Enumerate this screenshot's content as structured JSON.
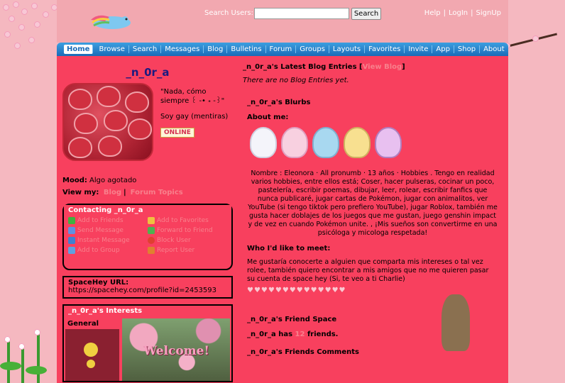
{
  "header": {
    "search_label": "Search Users:",
    "search_button": "Search",
    "links": [
      "Help",
      "LogIn",
      "SignUp"
    ]
  },
  "nav": [
    "Home",
    "Browse",
    "Search",
    "Messages",
    "Blog",
    "Bulletins",
    "Forum",
    "Groups",
    "Layouts",
    "Favorites",
    "Invite",
    "App",
    "Shop",
    "About"
  ],
  "profile": {
    "username": "_n_0r_a",
    "quote": "\"Nada, cómo siempre  ꒰ -•  ˖ -꒱\"",
    "subtext": "Soy gay (mentiras)",
    "online": "ONLINE",
    "mood_label": "Mood:",
    "mood": "Algo agotado",
    "view_my_label": "View my:",
    "view_my_links": [
      "Blog",
      "Forum Topics"
    ]
  },
  "contact": {
    "title": "Contacting _n_0r_a",
    "items": [
      "Add to Friends",
      "Add to Favorites",
      "Send Message",
      "Forward to Friend",
      "Instant Message",
      "Block User",
      "Add to Group",
      "Report User"
    ]
  },
  "url_box": {
    "title": "SpaceHey URL:",
    "url": "https://spacehey.com/profile?id=2453593"
  },
  "interests": {
    "title": "_n_0r_a's Interests",
    "general_label": "General"
  },
  "blog": {
    "title": "_n_0r_a's Latest Blog Entries [",
    "view_blog": "View Blog",
    "close": "]",
    "empty": "There are no Blog Entries yet."
  },
  "blurbs": {
    "title": "_n_0r_a's Blurbs",
    "about_title": "About me:",
    "about_text": "Nombre : Eleonora  · All pronumb · 13 años  · Hobbies . Tengo en realidad varios hobbies, entre ellos está; Coser, hacer pulseras, cocinar un poco, pastelería, escribir poemas, dibujar, leer, rolear, escribir fanfics que nunca publicaré, jugar cartas de Pokémon, jugar con animalitos, ver YouTube (si tengo tiktok pero prefiero YouTube), jugar Roblox, también me gusta hacer doblajes de los juegos que me gustan, juego genshin impact y de vez en cuando Pokémon unite. , ¡Mis sueños son convertirme en una psicóloga y micologa respetada!",
    "who_title": "Who I'd like to meet:",
    "who_text": "Me gustaría conocerte a alguien que comparta mis intereses o tal vez rolee, también quiero encontrar a mis amigos que no me quieren pasar su cuenta de space hey (Si, te veo a ti Charlie)"
  },
  "friend_space": {
    "title": "_n_0r_a's Friend Space",
    "has_prefix": "_n_0r_a has",
    "count": "12",
    "suffix": "friends.",
    "comments_title": "_n_0r_a's Friends Comments"
  }
}
